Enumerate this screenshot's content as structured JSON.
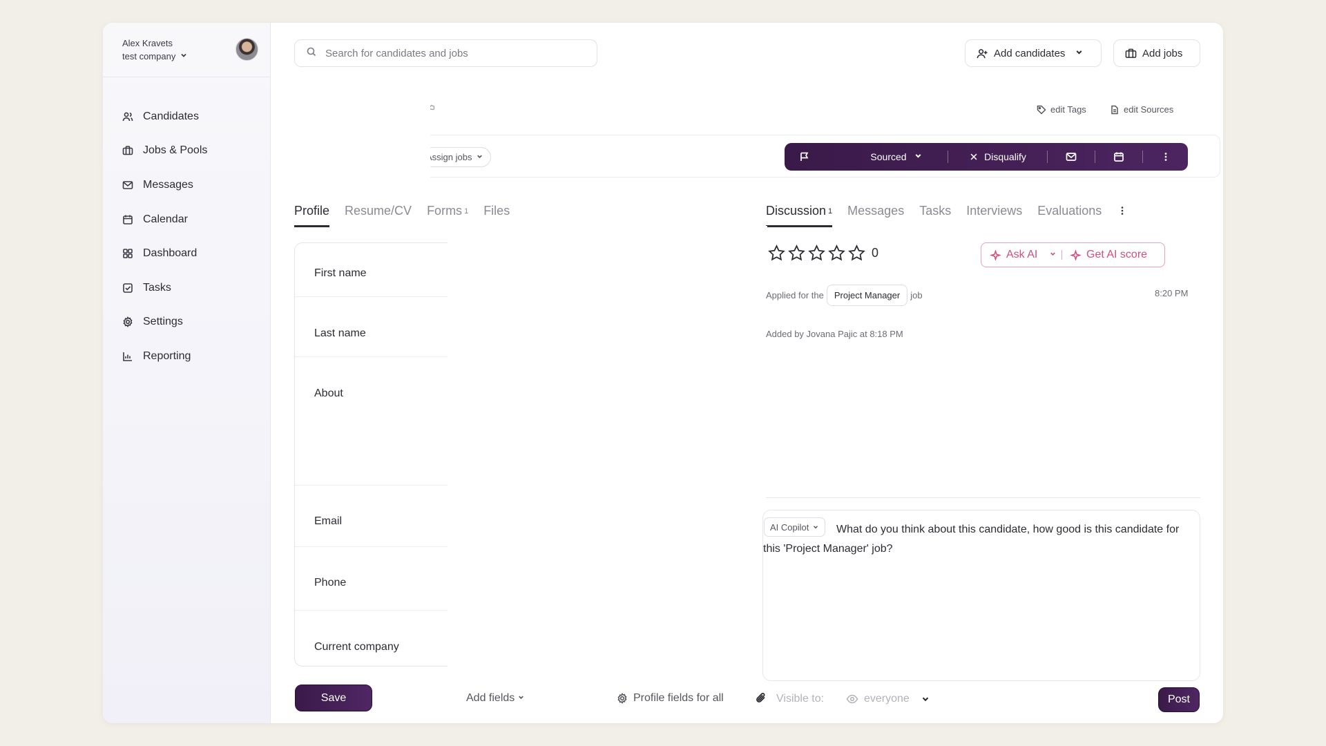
{
  "user": {
    "name": "Alex Kravets",
    "company": "test company"
  },
  "sidebar": {
    "items": [
      {
        "label": "Candidates",
        "icon": "users-icon"
      },
      {
        "label": "Jobs & Pools",
        "icon": "briefcase-icon"
      },
      {
        "label": "Messages",
        "icon": "mail-icon"
      },
      {
        "label": "Calendar",
        "icon": "calendar-icon"
      },
      {
        "label": "Dashboard",
        "icon": "grid-icon"
      },
      {
        "label": "Tasks",
        "icon": "checkbox-icon"
      },
      {
        "label": "Settings",
        "icon": "gear-icon"
      },
      {
        "label": "Reporting",
        "icon": "chart-icon"
      }
    ]
  },
  "header": {
    "search_placeholder": "Search for candidates and jobs",
    "add_candidates": "Add candidates",
    "add_jobs": "Add jobs"
  },
  "candidate": {
    "edit_tags": "edit Tags",
    "edit_sources": "edit Sources",
    "assign_jobs": "Assign jobs",
    "status": "Sourced",
    "disqualify": "Disqualify"
  },
  "tabs_left": [
    {
      "label": "Profile",
      "count": ""
    },
    {
      "label": "Resume/CV",
      "count": ""
    },
    {
      "label": "Forms",
      "count": "1"
    },
    {
      "label": "Files",
      "count": ""
    }
  ],
  "tabs_right": [
    {
      "label": "Discussion",
      "count": "1"
    },
    {
      "label": "Messages",
      "count": ""
    },
    {
      "label": "Tasks",
      "count": ""
    },
    {
      "label": "Interviews",
      "count": ""
    },
    {
      "label": "Evaluations",
      "count": ""
    }
  ],
  "profile_fields": [
    "First name",
    "Last name",
    "About",
    "Email",
    "Phone",
    "Current company"
  ],
  "discussion": {
    "rating": 0,
    "rating_count": "0",
    "ask_ai": "Ask AI",
    "get_ai_score": "Get AI score",
    "applied_prefix": "Applied for the",
    "applied_job": "Project Manager",
    "applied_suffix": "job",
    "time": "8:20 PM",
    "added_by": "Added by Jovana Pajic at 8:18 PM",
    "copilot": "AI Copilot",
    "composer_text": "What do you think about this candidate, how good is this candidate for this 'Project Manager' job?",
    "visible_to": "Visible to:",
    "visibility": "everyone",
    "post": "Post"
  },
  "footer": {
    "save": "Save",
    "add_fields": "Add fields",
    "profile_fields_all": "Profile fields for all"
  },
  "colors": {
    "accent": "#3a1a49",
    "ai_pink": "#d04f80",
    "sidebar_bg": "#f3f2f8",
    "page_bg": "#f2eee8"
  }
}
